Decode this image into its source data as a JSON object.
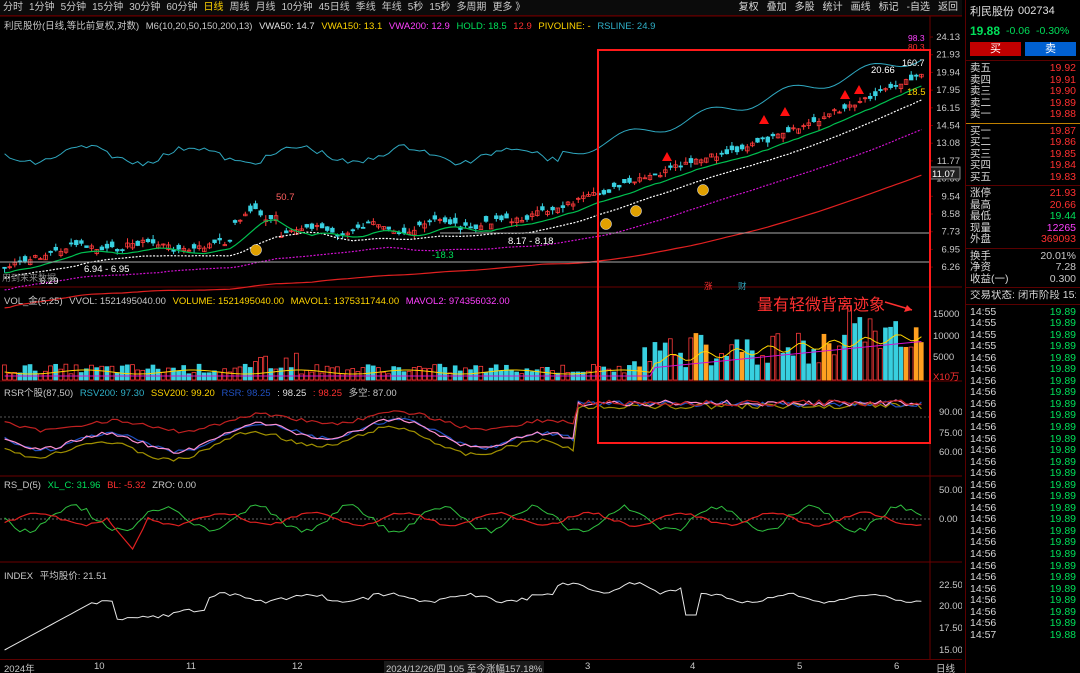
{
  "toolbar": {
    "periods": [
      "分时",
      "1分钟",
      "5分钟",
      "15分钟",
      "30分钟",
      "60分钟",
      "日线",
      "周线",
      "月线",
      "10分钟",
      "45日线",
      "季线",
      "年线",
      "5秒",
      "15秒",
      "多周期",
      "更多 》"
    ],
    "active_period": "日线",
    "tools": [
      "复权",
      "叠加",
      "多股",
      "统计",
      "画线",
      "标记",
      "-自选",
      "返回"
    ]
  },
  "main_legend": {
    "name": "利民股份(日线,等比前复权,对数)",
    "ma": "M6(10,20,50,150,200,13)",
    "vwa50": "VWA50: 14.7",
    "vwa150": "VWA150: 13.1",
    "vwa200": "VWA200: 12.9",
    "hold": "HOLD: 18.5",
    "hold2": "12.9",
    "pivoline": "PIVOLINE: -",
    "rsline": "RSLINE: 24.9"
  },
  "price_axis": [
    "24.13",
    "21.93",
    "19.94",
    "17.95",
    "16.15",
    "14.54",
    "13.08",
    "11.77",
    "10.60",
    "9.54",
    "8.58",
    "7.73",
    "6.95",
    "6.26"
  ],
  "price_tag": "11.07",
  "main_annotations": {
    "low_label": "6.29",
    "range1": "6.94 - 6.95",
    "peak": "50.7",
    "range2": "8.17 - 8.18",
    "green_label": "-18.3",
    "high_label": "20.66",
    "r1": "160.7",
    "r2": "98.3",
    "r3": "80.3",
    "yellow_label": "18.5",
    "left_note": "用到末来数据",
    "tag_zhang": "涨",
    "tag_cai": "财"
  },
  "vol_legend": {
    "name": "VOL_金(5,25)",
    "vvol": "VVOL: 1521495040.00",
    "volume": "VOLUME: 1521495040.00",
    "mavol1": "MAVOL1: 1375311744.00",
    "mavol2": "MAVOL2: 974356032.00"
  },
  "vol_axis": [
    "15000",
    "10000",
    "5000",
    "X10万"
  ],
  "annotation_text": "量有轻微背离迹象",
  "rsr_legend": {
    "name": "RSR个股(87,50)",
    "rsv200": "RSV200: 97.30",
    "ssv200": "SSV200: 99.20",
    "rsr": "RSR: 98.25",
    "v2": ": 98.25",
    "v3": ": 98.25",
    "duokong": "多空: 87.00"
  },
  "rsr_axis": [
    "90.00",
    "75.00",
    "60.00"
  ],
  "rsd_legend": {
    "name": "RS_D(5)",
    "xlc": "XL_C: 31.96",
    "bl": "BL: -5.32",
    "zro": "ZRO: 0.00"
  },
  "rsd_axis": [
    "50.00",
    "0.00"
  ],
  "index_legend": {
    "name": "INDEX",
    "avg": "平均股价: 21.51"
  },
  "index_axis": [
    "22.50",
    "20.00",
    "17.50",
    "15.00"
  ],
  "bottom": {
    "year": "2024年",
    "months": [
      "10",
      "11",
      "12",
      "2",
      "3",
      "4",
      "5",
      "6"
    ],
    "info": "2024/12/26/四 105 至今涨幅157.18%",
    "period": "日线"
  },
  "panel": {
    "name": "利民股份",
    "code": "002734",
    "price": "19.88",
    "change": "-0.06",
    "pct": "-0.30%",
    "buy_label": "买",
    "sell_label": "卖",
    "asks": [
      {
        "k": "卖五",
        "v": "19.92"
      },
      {
        "k": "卖四",
        "v": "19.91"
      },
      {
        "k": "卖三",
        "v": "19.90"
      },
      {
        "k": "卖二",
        "v": "19.89"
      },
      {
        "k": "卖一",
        "v": "19.88"
      }
    ],
    "bids": [
      {
        "k": "买一",
        "v": "19.87"
      },
      {
        "k": "买二",
        "v": "19.86"
      },
      {
        "k": "买三",
        "v": "19.85"
      },
      {
        "k": "买四",
        "v": "19.84"
      },
      {
        "k": "买五",
        "v": "19.83"
      }
    ],
    "stats": [
      {
        "k": "涨停",
        "v": "21.93",
        "c": "red"
      },
      {
        "k": "最高",
        "v": "20.66",
        "c": "red"
      },
      {
        "k": "最低",
        "v": "19.44",
        "c": "green"
      },
      {
        "k": "现量",
        "v": "12265",
        "c": "magenta"
      },
      {
        "k": "外盘",
        "v": "369093",
        "c": "red"
      }
    ],
    "stats2": [
      {
        "k": "换手",
        "v": "20.01%"
      },
      {
        "k": "净资",
        "v": "7.28"
      },
      {
        "k": "收益(一)",
        "v": "0.300"
      }
    ],
    "status": "交易状态: 闭市阶段 15:0",
    "ticks": [
      {
        "t": "14:55",
        "v": "19.89"
      },
      {
        "t": "14:55",
        "v": "19.89"
      },
      {
        "t": "14:55",
        "v": "19.89"
      },
      {
        "t": "14:55",
        "v": "19.89"
      },
      {
        "t": "14:56",
        "v": "19.89"
      },
      {
        "t": "14:56",
        "v": "19.89"
      },
      {
        "t": "14:56",
        "v": "19.89"
      },
      {
        "t": "14:56",
        "v": "19.89"
      },
      {
        "t": "14:56",
        "v": "19.89"
      },
      {
        "t": "14:56",
        "v": "19.89"
      },
      {
        "t": "14:56",
        "v": "19.89"
      },
      {
        "t": "14:56",
        "v": "19.89"
      },
      {
        "t": "14:56",
        "v": "19.89"
      },
      {
        "t": "14:56",
        "v": "19.89"
      },
      {
        "t": "14:56",
        "v": "19.89"
      },
      {
        "t": "14:56",
        "v": "19.89"
      },
      {
        "t": "14:56",
        "v": "19.89"
      },
      {
        "t": "14:56",
        "v": "19.89"
      },
      {
        "t": "14:56",
        "v": "19.89"
      },
      {
        "t": "14:56",
        "v": "19.89"
      },
      {
        "t": "14:56",
        "v": "19.89"
      },
      {
        "t": "14:56",
        "v": "19.89"
      },
      {
        "t": "14:56",
        "v": "19.89"
      },
      {
        "t": "14:56",
        "v": "19.89"
      },
      {
        "t": "14:56",
        "v": "19.89"
      },
      {
        "t": "14:56",
        "v": "19.89"
      },
      {
        "t": "14:56",
        "v": "19.89"
      },
      {
        "t": "14:56",
        "v": "19.89"
      },
      {
        "t": "14:57",
        "v": "19.88"
      }
    ]
  }
}
